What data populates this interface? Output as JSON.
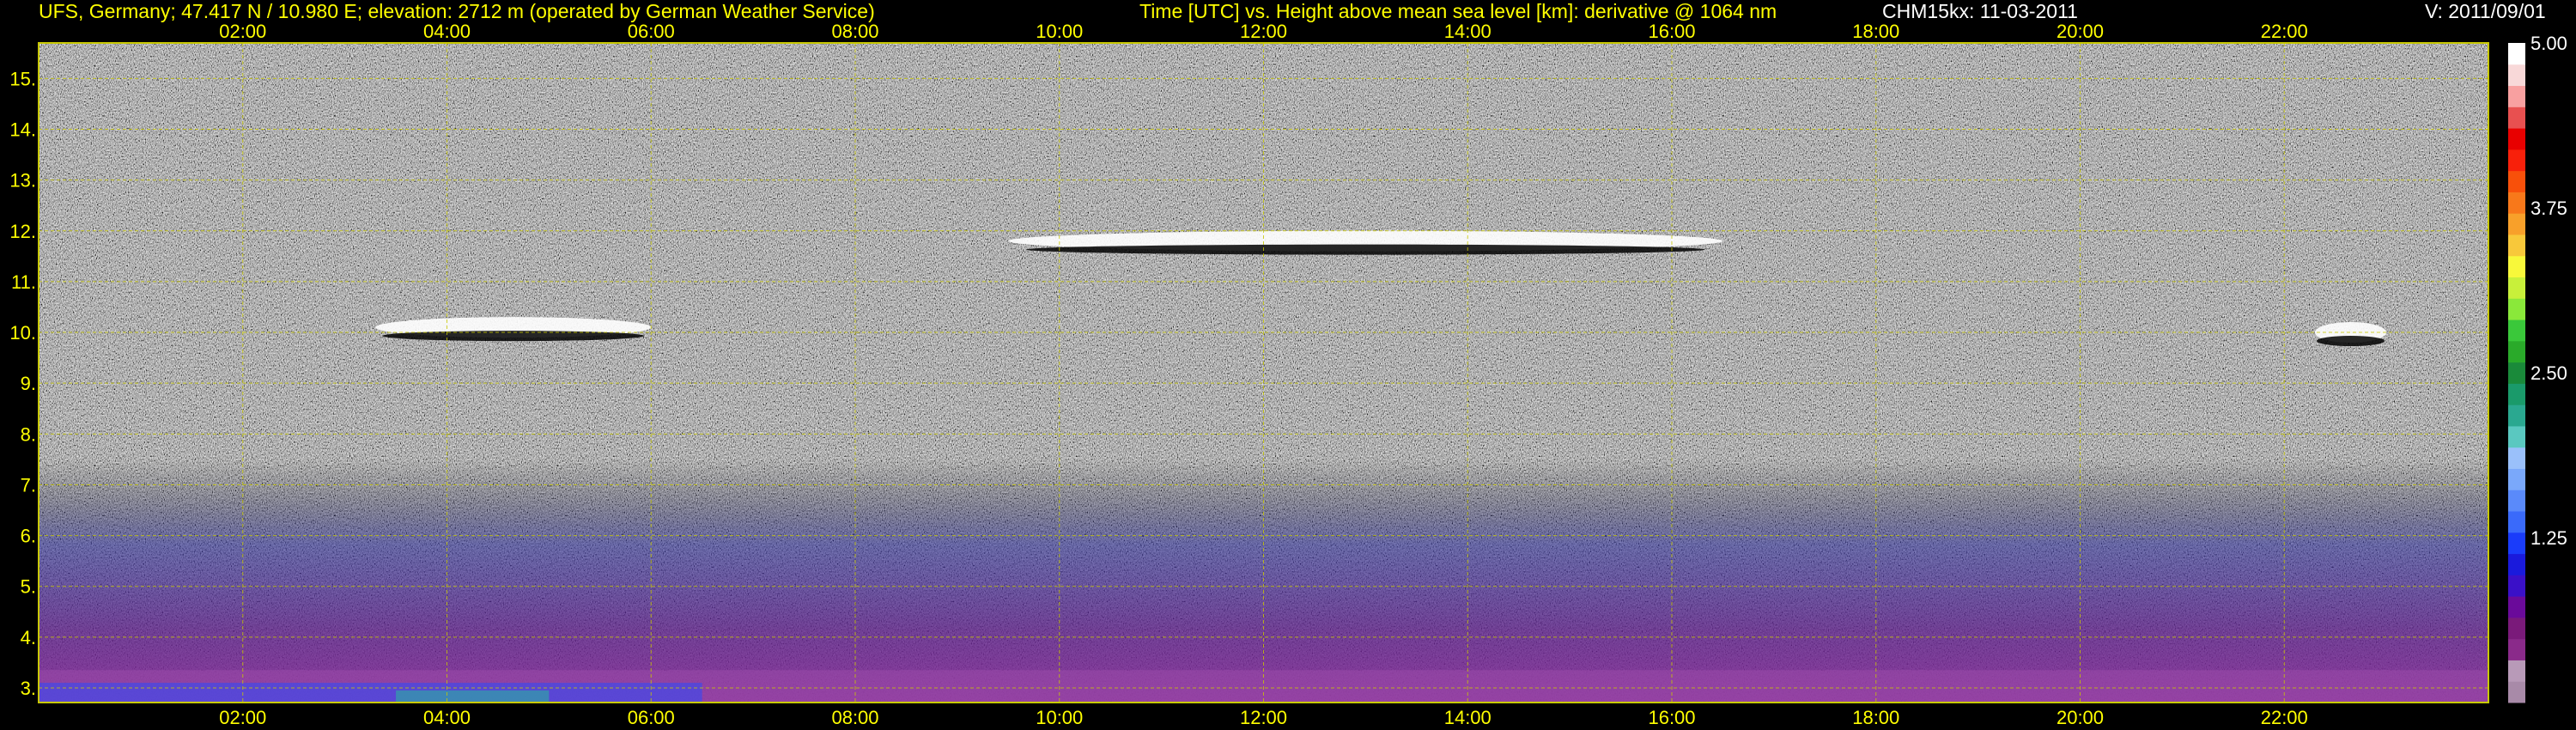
{
  "header": {
    "station": "UFS, Germany; 47.417 N / 10.980 E; elevation: 2712 m  (operated by German Weather Service)",
    "description": "Time [UTC] vs. Height above mean sea level [km]: derivative @ 1064 nm",
    "instrument": "CHM15kx: 11-03-2011",
    "version": "V: 2011/09/01"
  },
  "colors": {
    "background": "#000000",
    "text_yellow": "#ffff00",
    "text_white": "#ffffff",
    "grid": "#c8c800",
    "plot_gray": "#8a8a8a"
  },
  "chart_data": {
    "type": "heatmap",
    "x_unit": "hours UTC",
    "y_unit": "km",
    "xlim": [
      0,
      24
    ],
    "ylim": [
      2.712,
      15.7
    ],
    "x_ticks": [
      2,
      4,
      6,
      8,
      10,
      12,
      14,
      16,
      18,
      20,
      22
    ],
    "x_tick_labels": [
      "02:00",
      "04:00",
      "06:00",
      "08:00",
      "10:00",
      "12:00",
      "14:00",
      "16:00",
      "18:00",
      "20:00",
      "22:00"
    ],
    "y_ticks": [
      3,
      4,
      5,
      6,
      7,
      8,
      9,
      10,
      11,
      12,
      13,
      14,
      15
    ],
    "y_tick_labels": [
      "3.",
      "4.",
      "5.",
      "6.",
      "7.",
      "8.",
      "9.",
      "10.",
      "11.",
      "12.",
      "13.",
      "14.",
      "15."
    ],
    "grid": true,
    "colorbar": {
      "ticks": [
        1.25,
        2.5,
        3.75,
        5.0
      ],
      "tick_labels": [
        "1.25",
        "2.50",
        "3.75",
        "5.00"
      ],
      "range": [
        0,
        5.0
      ],
      "colors": [
        "#a88aa8",
        "#b89ab8",
        "#8a2a8a",
        "#7a1a7a",
        "#6a0a9a",
        "#3a10c8",
        "#1a1adc",
        "#1a3cfa",
        "#3a6afa",
        "#5a8afa",
        "#7aa8fa",
        "#9ac0fa",
        "#5ac8c0",
        "#2aa890",
        "#1a9a6a",
        "#1a8a3a",
        "#2aaa2a",
        "#3ac83a",
        "#8ae83a",
        "#c8f03a",
        "#f8f83a",
        "#f8c83a",
        "#f8a02a",
        "#f8781a",
        "#f8500a",
        "#f8200a",
        "#e80000",
        "#e85050",
        "#f8a0a0",
        "#f8d8d8",
        "#ffffff"
      ]
    },
    "features": [
      {
        "kind": "cloud",
        "t_start": 3.3,
        "t_end": 6.0,
        "height_km": 10.1
      },
      {
        "kind": "cloud",
        "t_start": 9.5,
        "t_end": 16.5,
        "height_km": 11.8
      },
      {
        "kind": "cloud",
        "t_start": 22.3,
        "t_end": 23.0,
        "height_km": 10.0
      }
    ]
  }
}
